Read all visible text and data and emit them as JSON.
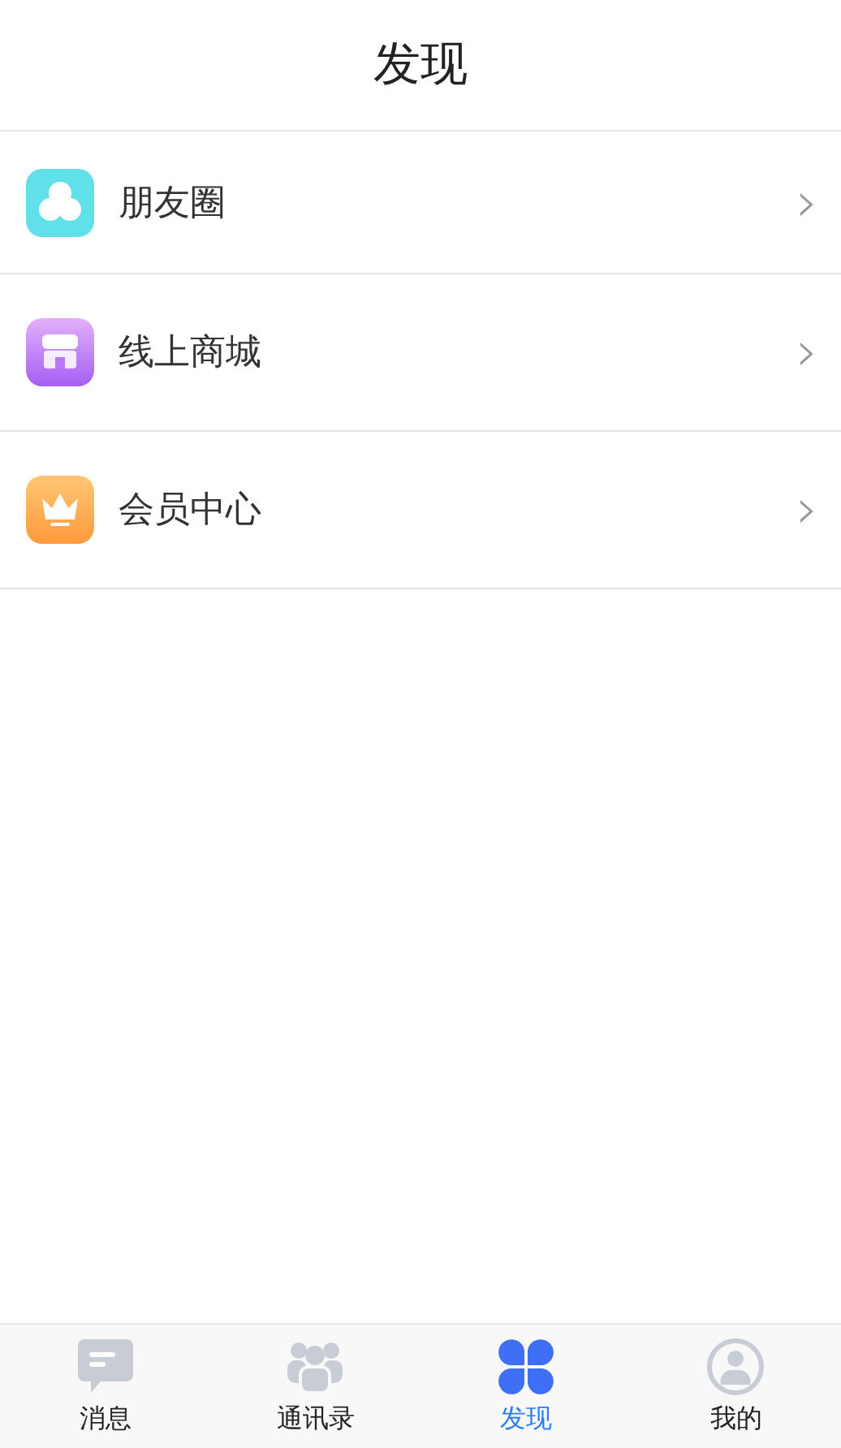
{
  "header": {
    "title": "发现"
  },
  "items": [
    {
      "kind": "moments",
      "label": "朋友圈",
      "arrow": "›"
    },
    {
      "kind": "shop",
      "label": "线上商城",
      "arrow": "›"
    },
    {
      "kind": "vip",
      "label": "会员中心",
      "arrow": "›"
    }
  ],
  "tab_bar": [
    {
      "kind": "chat",
      "label": "消息",
      "selected": false
    },
    {
      "kind": "contacts",
      "label": "通讯录",
      "selected": false
    },
    {
      "kind": "discover",
      "label": "发现",
      "selected": true
    },
    {
      "kind": "me",
      "label": "我的",
      "selected": false
    }
  ]
}
